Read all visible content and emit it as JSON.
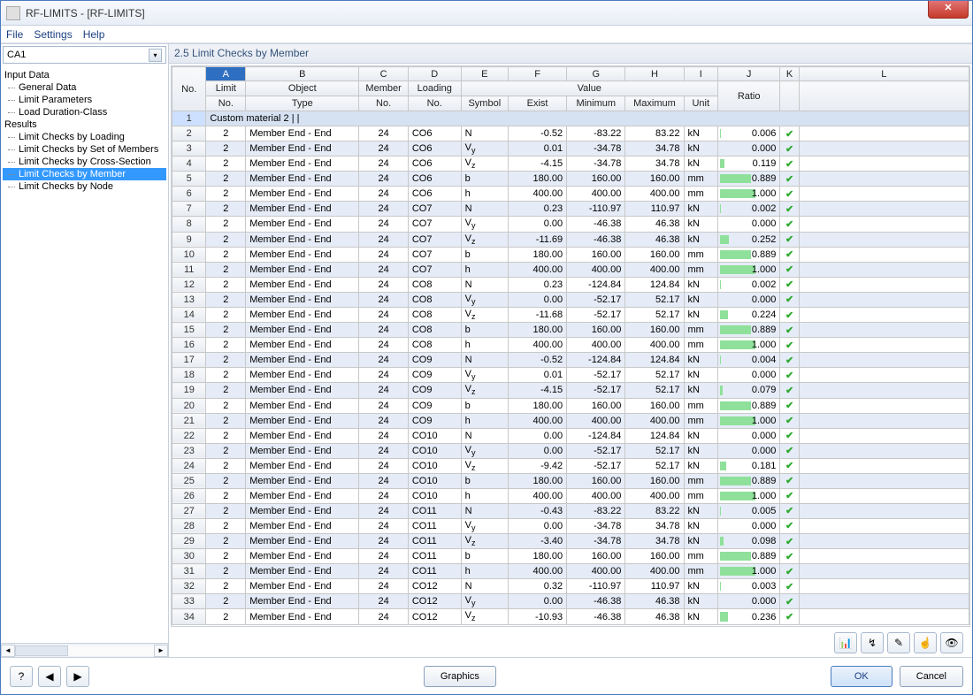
{
  "window": {
    "title": "RF-LIMITS - [RF-LIMITS]",
    "close_glyph": "✕"
  },
  "menu": [
    "File",
    "Settings",
    "Help"
  ],
  "combo": {
    "value": "CA1",
    "arrow": "▾"
  },
  "tree": {
    "top1": "Input Data",
    "group1": [
      "General Data",
      "Limit Parameters",
      "Load Duration-Class"
    ],
    "top2": "Results",
    "group2": [
      "Limit Checks by Loading",
      "Limit Checks by Set of Members",
      "Limit Checks by Cross-Section",
      "Limit Checks by Member",
      "Limit Checks by Node"
    ],
    "selected_index": 3
  },
  "panel_title": "2.5 Limit Checks by Member",
  "letters": [
    "A",
    "B",
    "C",
    "D",
    "E",
    "F",
    "G",
    "H",
    "I",
    "J",
    "K",
    "L"
  ],
  "headers": {
    "no": "No.",
    "limit_no": "Limit\nNo.",
    "object_type": "Object\nType",
    "member_no": "Member\nNo.",
    "loading_no": "Loading\nNo.",
    "value": "Value",
    "symbol": "Symbol",
    "exist": "Exist",
    "minimum": "Minimum",
    "maximum": "Maximum",
    "unit": "Unit",
    "ratio": "Ratio"
  },
  "section_label": "Custom material 2 | |",
  "rows": [
    {
      "n": 2,
      "l": 2,
      "ot": "Member End - End",
      "m": 24,
      "ld": "CO6",
      "sym": "N",
      "ex": "-0.52",
      "mn": "-83.22",
      "mx": "83.22",
      "u": "kN",
      "r": 0.006
    },
    {
      "n": 3,
      "l": 2,
      "ot": "Member End - End",
      "m": 24,
      "ld": "CO6",
      "sym": "Vy",
      "ex": "0.01",
      "mn": "-34.78",
      "mx": "34.78",
      "u": "kN",
      "r": 0.0
    },
    {
      "n": 4,
      "l": 2,
      "ot": "Member End - End",
      "m": 24,
      "ld": "CO6",
      "sym": "Vz",
      "ex": "-4.15",
      "mn": "-34.78",
      "mx": "34.78",
      "u": "kN",
      "r": 0.119
    },
    {
      "n": 5,
      "l": 2,
      "ot": "Member End - End",
      "m": 24,
      "ld": "CO6",
      "sym": "b",
      "ex": "180.00",
      "mn": "160.00",
      "mx": "160.00",
      "u": "mm",
      "r": 0.889
    },
    {
      "n": 6,
      "l": 2,
      "ot": "Member End - End",
      "m": 24,
      "ld": "CO6",
      "sym": "h",
      "ex": "400.00",
      "mn": "400.00",
      "mx": "400.00",
      "u": "mm",
      "r": 1.0
    },
    {
      "n": 7,
      "l": 2,
      "ot": "Member End - End",
      "m": 24,
      "ld": "CO7",
      "sym": "N",
      "ex": "0.23",
      "mn": "-110.97",
      "mx": "110.97",
      "u": "kN",
      "r": 0.002
    },
    {
      "n": 8,
      "l": 2,
      "ot": "Member End - End",
      "m": 24,
      "ld": "CO7",
      "sym": "Vy",
      "ex": "0.00",
      "mn": "-46.38",
      "mx": "46.38",
      "u": "kN",
      "r": 0.0
    },
    {
      "n": 9,
      "l": 2,
      "ot": "Member End - End",
      "m": 24,
      "ld": "CO7",
      "sym": "Vz",
      "ex": "-11.69",
      "mn": "-46.38",
      "mx": "46.38",
      "u": "kN",
      "r": 0.252
    },
    {
      "n": 10,
      "l": 2,
      "ot": "Member End - End",
      "m": 24,
      "ld": "CO7",
      "sym": "b",
      "ex": "180.00",
      "mn": "160.00",
      "mx": "160.00",
      "u": "mm",
      "r": 0.889
    },
    {
      "n": 11,
      "l": 2,
      "ot": "Member End - End",
      "m": 24,
      "ld": "CO7",
      "sym": "h",
      "ex": "400.00",
      "mn": "400.00",
      "mx": "400.00",
      "u": "mm",
      "r": 1.0
    },
    {
      "n": 12,
      "l": 2,
      "ot": "Member End - End",
      "m": 24,
      "ld": "CO8",
      "sym": "N",
      "ex": "0.23",
      "mn": "-124.84",
      "mx": "124.84",
      "u": "kN",
      "r": 0.002
    },
    {
      "n": 13,
      "l": 2,
      "ot": "Member End - End",
      "m": 24,
      "ld": "CO8",
      "sym": "Vy",
      "ex": "0.00",
      "mn": "-52.17",
      "mx": "52.17",
      "u": "kN",
      "r": 0.0
    },
    {
      "n": 14,
      "l": 2,
      "ot": "Member End - End",
      "m": 24,
      "ld": "CO8",
      "sym": "Vz",
      "ex": "-11.68",
      "mn": "-52.17",
      "mx": "52.17",
      "u": "kN",
      "r": 0.224
    },
    {
      "n": 15,
      "l": 2,
      "ot": "Member End - End",
      "m": 24,
      "ld": "CO8",
      "sym": "b",
      "ex": "180.00",
      "mn": "160.00",
      "mx": "160.00",
      "u": "mm",
      "r": 0.889
    },
    {
      "n": 16,
      "l": 2,
      "ot": "Member End - End",
      "m": 24,
      "ld": "CO8",
      "sym": "h",
      "ex": "400.00",
      "mn": "400.00",
      "mx": "400.00",
      "u": "mm",
      "r": 1.0
    },
    {
      "n": 17,
      "l": 2,
      "ot": "Member End - End",
      "m": 24,
      "ld": "CO9",
      "sym": "N",
      "ex": "-0.52",
      "mn": "-124.84",
      "mx": "124.84",
      "u": "kN",
      "r": 0.004
    },
    {
      "n": 18,
      "l": 2,
      "ot": "Member End - End",
      "m": 24,
      "ld": "CO9",
      "sym": "Vy",
      "ex": "0.01",
      "mn": "-52.17",
      "mx": "52.17",
      "u": "kN",
      "r": 0.0
    },
    {
      "n": 19,
      "l": 2,
      "ot": "Member End - End",
      "m": 24,
      "ld": "CO9",
      "sym": "Vz",
      "ex": "-4.15",
      "mn": "-52.17",
      "mx": "52.17",
      "u": "kN",
      "r": 0.079
    },
    {
      "n": 20,
      "l": 2,
      "ot": "Member End - End",
      "m": 24,
      "ld": "CO9",
      "sym": "b",
      "ex": "180.00",
      "mn": "160.00",
      "mx": "160.00",
      "u": "mm",
      "r": 0.889
    },
    {
      "n": 21,
      "l": 2,
      "ot": "Member End - End",
      "m": 24,
      "ld": "CO9",
      "sym": "h",
      "ex": "400.00",
      "mn": "400.00",
      "mx": "400.00",
      "u": "mm",
      "r": 1.0
    },
    {
      "n": 22,
      "l": 2,
      "ot": "Member End - End",
      "m": 24,
      "ld": "CO10",
      "sym": "N",
      "ex": "0.00",
      "mn": "-124.84",
      "mx": "124.84",
      "u": "kN",
      "r": 0.0
    },
    {
      "n": 23,
      "l": 2,
      "ot": "Member End - End",
      "m": 24,
      "ld": "CO10",
      "sym": "Vy",
      "ex": "0.00",
      "mn": "-52.17",
      "mx": "52.17",
      "u": "kN",
      "r": 0.0
    },
    {
      "n": 24,
      "l": 2,
      "ot": "Member End - End",
      "m": 24,
      "ld": "CO10",
      "sym": "Vz",
      "ex": "-9.42",
      "mn": "-52.17",
      "mx": "52.17",
      "u": "kN",
      "r": 0.181
    },
    {
      "n": 25,
      "l": 2,
      "ot": "Member End - End",
      "m": 24,
      "ld": "CO10",
      "sym": "b",
      "ex": "180.00",
      "mn": "160.00",
      "mx": "160.00",
      "u": "mm",
      "r": 0.889
    },
    {
      "n": 26,
      "l": 2,
      "ot": "Member End - End",
      "m": 24,
      "ld": "CO10",
      "sym": "h",
      "ex": "400.00",
      "mn": "400.00",
      "mx": "400.00",
      "u": "mm",
      "r": 1.0
    },
    {
      "n": 27,
      "l": 2,
      "ot": "Member End - End",
      "m": 24,
      "ld": "CO11",
      "sym": "N",
      "ex": "-0.43",
      "mn": "-83.22",
      "mx": "83.22",
      "u": "kN",
      "r": 0.005
    },
    {
      "n": 28,
      "l": 2,
      "ot": "Member End - End",
      "m": 24,
      "ld": "CO11",
      "sym": "Vy",
      "ex": "0.00",
      "mn": "-34.78",
      "mx": "34.78",
      "u": "kN",
      "r": 0.0
    },
    {
      "n": 29,
      "l": 2,
      "ot": "Member End - End",
      "m": 24,
      "ld": "CO11",
      "sym": "Vz",
      "ex": "-3.40",
      "mn": "-34.78",
      "mx": "34.78",
      "u": "kN",
      "r": 0.098
    },
    {
      "n": 30,
      "l": 2,
      "ot": "Member End - End",
      "m": 24,
      "ld": "CO11",
      "sym": "b",
      "ex": "180.00",
      "mn": "160.00",
      "mx": "160.00",
      "u": "mm",
      "r": 0.889
    },
    {
      "n": 31,
      "l": 2,
      "ot": "Member End - End",
      "m": 24,
      "ld": "CO11",
      "sym": "h",
      "ex": "400.00",
      "mn": "400.00",
      "mx": "400.00",
      "u": "mm",
      "r": 1.0
    },
    {
      "n": 32,
      "l": 2,
      "ot": "Member End - End",
      "m": 24,
      "ld": "CO12",
      "sym": "N",
      "ex": "0.32",
      "mn": "-110.97",
      "mx": "110.97",
      "u": "kN",
      "r": 0.003
    },
    {
      "n": 33,
      "l": 2,
      "ot": "Member End - End",
      "m": 24,
      "ld": "CO12",
      "sym": "Vy",
      "ex": "0.00",
      "mn": "-46.38",
      "mx": "46.38",
      "u": "kN",
      "r": 0.0
    },
    {
      "n": 34,
      "l": 2,
      "ot": "Member End - End",
      "m": 24,
      "ld": "CO12",
      "sym": "Vz",
      "ex": "-10.93",
      "mn": "-46.38",
      "mx": "46.38",
      "u": "kN",
      "r": 0.236
    }
  ],
  "toolbar_icons": [
    "📊",
    "↯",
    "✎",
    "☝",
    "👁"
  ],
  "bottom": {
    "help": "?",
    "nav_prev": "◀",
    "nav_next": "▶",
    "graphics": "Graphics",
    "ok": "OK",
    "cancel": "Cancel"
  }
}
